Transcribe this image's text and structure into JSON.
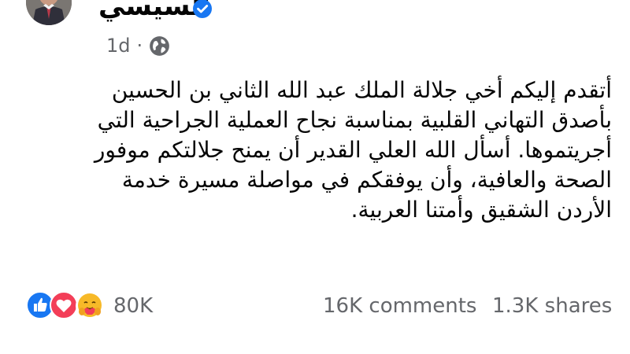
{
  "post": {
    "author": "السيسي",
    "verified": true,
    "time": "1d",
    "separator": "·",
    "audience_icon": "globe-icon",
    "text_lines": [
      "أتقدم إليكم أخي جلالة الملك عبد الله الثاني بن الحسين",
      "بأصدق التهاني القلبية بمناسبة نجاح العملية الجراحية التي",
      "أجريتموها. أسأل الله العلي القدير أن يمنح جلالتكم موفور",
      "الصحة والعافية، وأن يوفقكم في مواصلة مسيرة خدمة",
      "الأردن الشقيق وأمتنا العربية."
    ]
  },
  "engagement": {
    "reaction_icons": [
      "like-icon",
      "love-icon",
      "care-icon"
    ],
    "reactions_count": "80K",
    "comments": "16K comments",
    "shares": "1.3K shares"
  },
  "colors": {
    "text": "#050505",
    "secondary": "#65676b",
    "verified_blue": "#1877f2",
    "love_red": "#f33e58",
    "care_yellow": "#f7b928"
  }
}
